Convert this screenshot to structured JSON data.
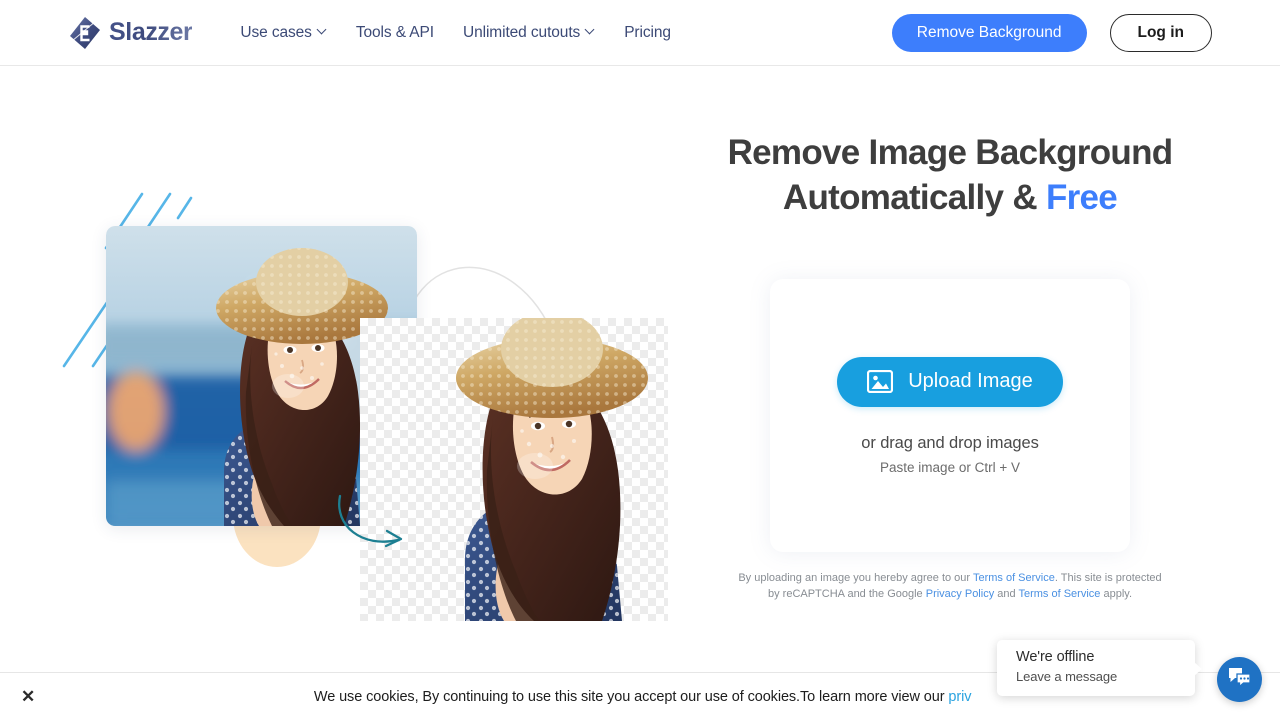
{
  "header": {
    "logo_text": "Slazzer",
    "logo_icon": "slazzer-diamond-logo",
    "nav": [
      {
        "label": "Use cases",
        "has_caret": true
      },
      {
        "label": "Tools & API",
        "has_caret": false
      },
      {
        "label": "Unlimited cutouts",
        "has_caret": true
      },
      {
        "label": "Pricing",
        "has_caret": false
      }
    ],
    "remove_bg_label": "Remove Background",
    "login_label": "Log in",
    "accent_blue": "#3d7efc"
  },
  "hero": {
    "headline_line1": "Remove Image Background",
    "headline_line2_prefix": "Automatically & ",
    "headline_highlight": "Free",
    "highlight_color": "#3d7efc"
  },
  "upload": {
    "button_label": "Upload Image",
    "button_icon": "image-icon",
    "button_color": "#189fdf",
    "drag_text": "or drag and drop images",
    "paste_text": "Paste image or Ctrl + V"
  },
  "legal": {
    "part1": "By uploading an image you hereby agree to our ",
    "link1": "Terms of Service",
    "part2": ". This site is protected by reCAPTCHA and the Google ",
    "link2": "Privacy Policy",
    "part3": " and ",
    "link3": "Terms of Service",
    "part4": " apply.",
    "link_color": "#4a90e2"
  },
  "cookie": {
    "close_icon": "close-icon",
    "text": "We use cookies, By continuing to use this site you accept our use of cookies.To learn more view our ",
    "link": "priv",
    "link_color": "#2aa3e0"
  },
  "chat": {
    "title": "We're offline",
    "subtitle": "Leave a message",
    "fab_icon": "chat-bubbles-icon",
    "fab_color": "#1f72c4"
  }
}
